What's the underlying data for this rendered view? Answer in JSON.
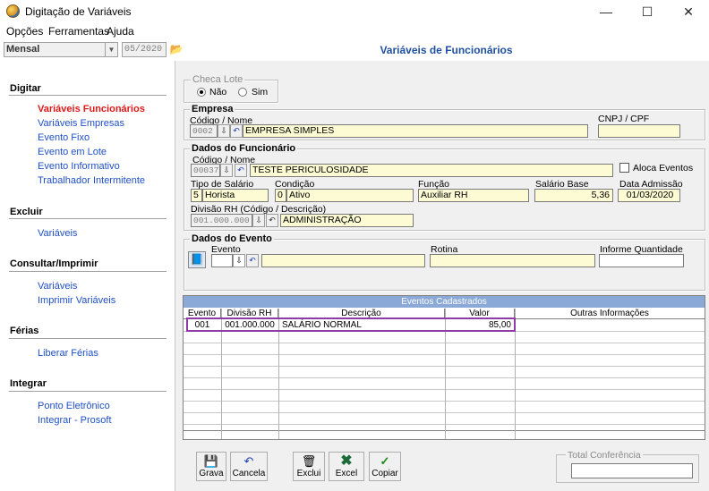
{
  "window": {
    "title": "Digitação de Variáveis",
    "minimize": "—",
    "maximize": "☐",
    "close": "✕"
  },
  "menu": [
    "Opções",
    "Ferramentas",
    "Ajuda"
  ],
  "toolbar": {
    "period": "Mensal",
    "date": "05/2020"
  },
  "page_title": "Variáveis de Funcionários",
  "sidebar": {
    "sections": [
      {
        "title": "Digitar",
        "items": [
          "Variáveis Funcionários",
          "Variáveis Empresas",
          "Evento Fixo",
          "Evento em Lote",
          "Evento Informativo",
          "Trabalhador Intermitente"
        ]
      },
      {
        "title": "Excluir",
        "items": [
          "Variáveis"
        ]
      },
      {
        "title": "Consultar/Imprimir",
        "items": [
          "Variáveis",
          "Imprimir Variáveis"
        ]
      },
      {
        "title": "Férias",
        "items": [
          "Liberar Férias"
        ]
      },
      {
        "title": "Integrar",
        "items": [
          "Ponto Eletrônico",
          "Integrar - Prosoft"
        ]
      }
    ]
  },
  "checa_lote": {
    "label": "Checa Lote",
    "option_no": "Não",
    "option_yes": "Sim"
  },
  "empresa": {
    "label": "Empresa",
    "code_label": "Código / Nome",
    "code": "0002",
    "name": "EMPRESA SIMPLES",
    "cnpj_label": "CNPJ / CPF",
    "cnpj": ""
  },
  "funcionario": {
    "label": "Dados do Funcionário",
    "code_label": "Código / Nome",
    "code": "00037",
    "name": "TESTE PERICULOSIDADE",
    "aloca_label": "Aloca Eventos",
    "tipo_label": "Tipo de Salário",
    "tipo_code": "5",
    "tipo": "Horista",
    "condicao_label": "Condição",
    "condicao_code": "0",
    "condicao": "Ativo",
    "funcao_label": "Função",
    "funcao": "Auxiliar RH",
    "salario_label": "Salário Base",
    "salario": "5,36",
    "admissao_label": "Data Admissão",
    "admissao": "01/03/2020",
    "divisao_label": "Divisão RH (Código / Descrição)",
    "divisao_code": "001.000.000",
    "divisao": "ADMINISTRAÇÃO"
  },
  "evento": {
    "label": "Dados do Evento",
    "evento_label": "Evento",
    "rotina_label": "Rotina",
    "quantidade_label": "Informe Quantidade"
  },
  "grid": {
    "caption": "Eventos Cadastrados",
    "headers": [
      "Evento",
      "Divisão RH",
      "Descrição",
      "Valor",
      "Outras Informações"
    ],
    "rows": [
      [
        "001",
        "001.000.000",
        "SALÁRIO NORMAL",
        "85,00",
        ""
      ]
    ]
  },
  "buttons": {
    "grava": "Grava",
    "cancela": "Cancela",
    "exclui": "Exclui",
    "excel": "Excel",
    "copiar": "Copiar"
  },
  "total": {
    "label": "Total Conferência",
    "value": ""
  }
}
